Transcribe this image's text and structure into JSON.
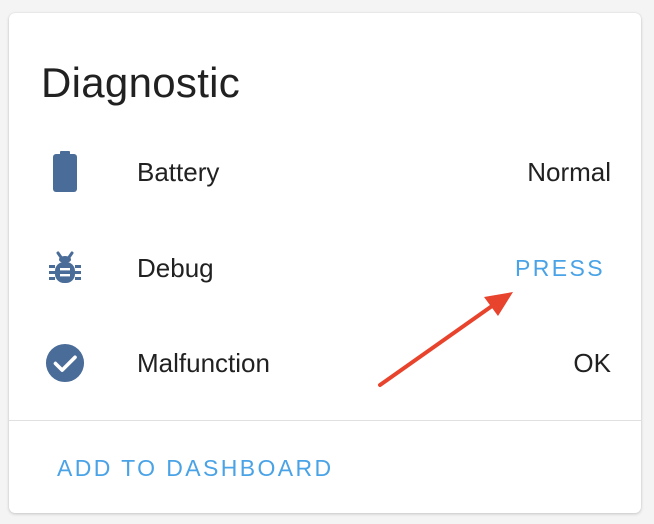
{
  "card": {
    "title": "Diagnostic",
    "rows": [
      {
        "icon": "battery-icon",
        "label": "Battery",
        "value": "Normal"
      },
      {
        "icon": "bug-icon",
        "label": "Debug",
        "action": "PRESS"
      },
      {
        "icon": "check-circle-icon",
        "label": "Malfunction",
        "value": "OK"
      }
    ],
    "footer_button": "ADD TO DASHBOARD"
  },
  "colors": {
    "icon": "#4a6c98",
    "accent": "#4aa3e6",
    "annotation_arrow": "#e8432c"
  }
}
